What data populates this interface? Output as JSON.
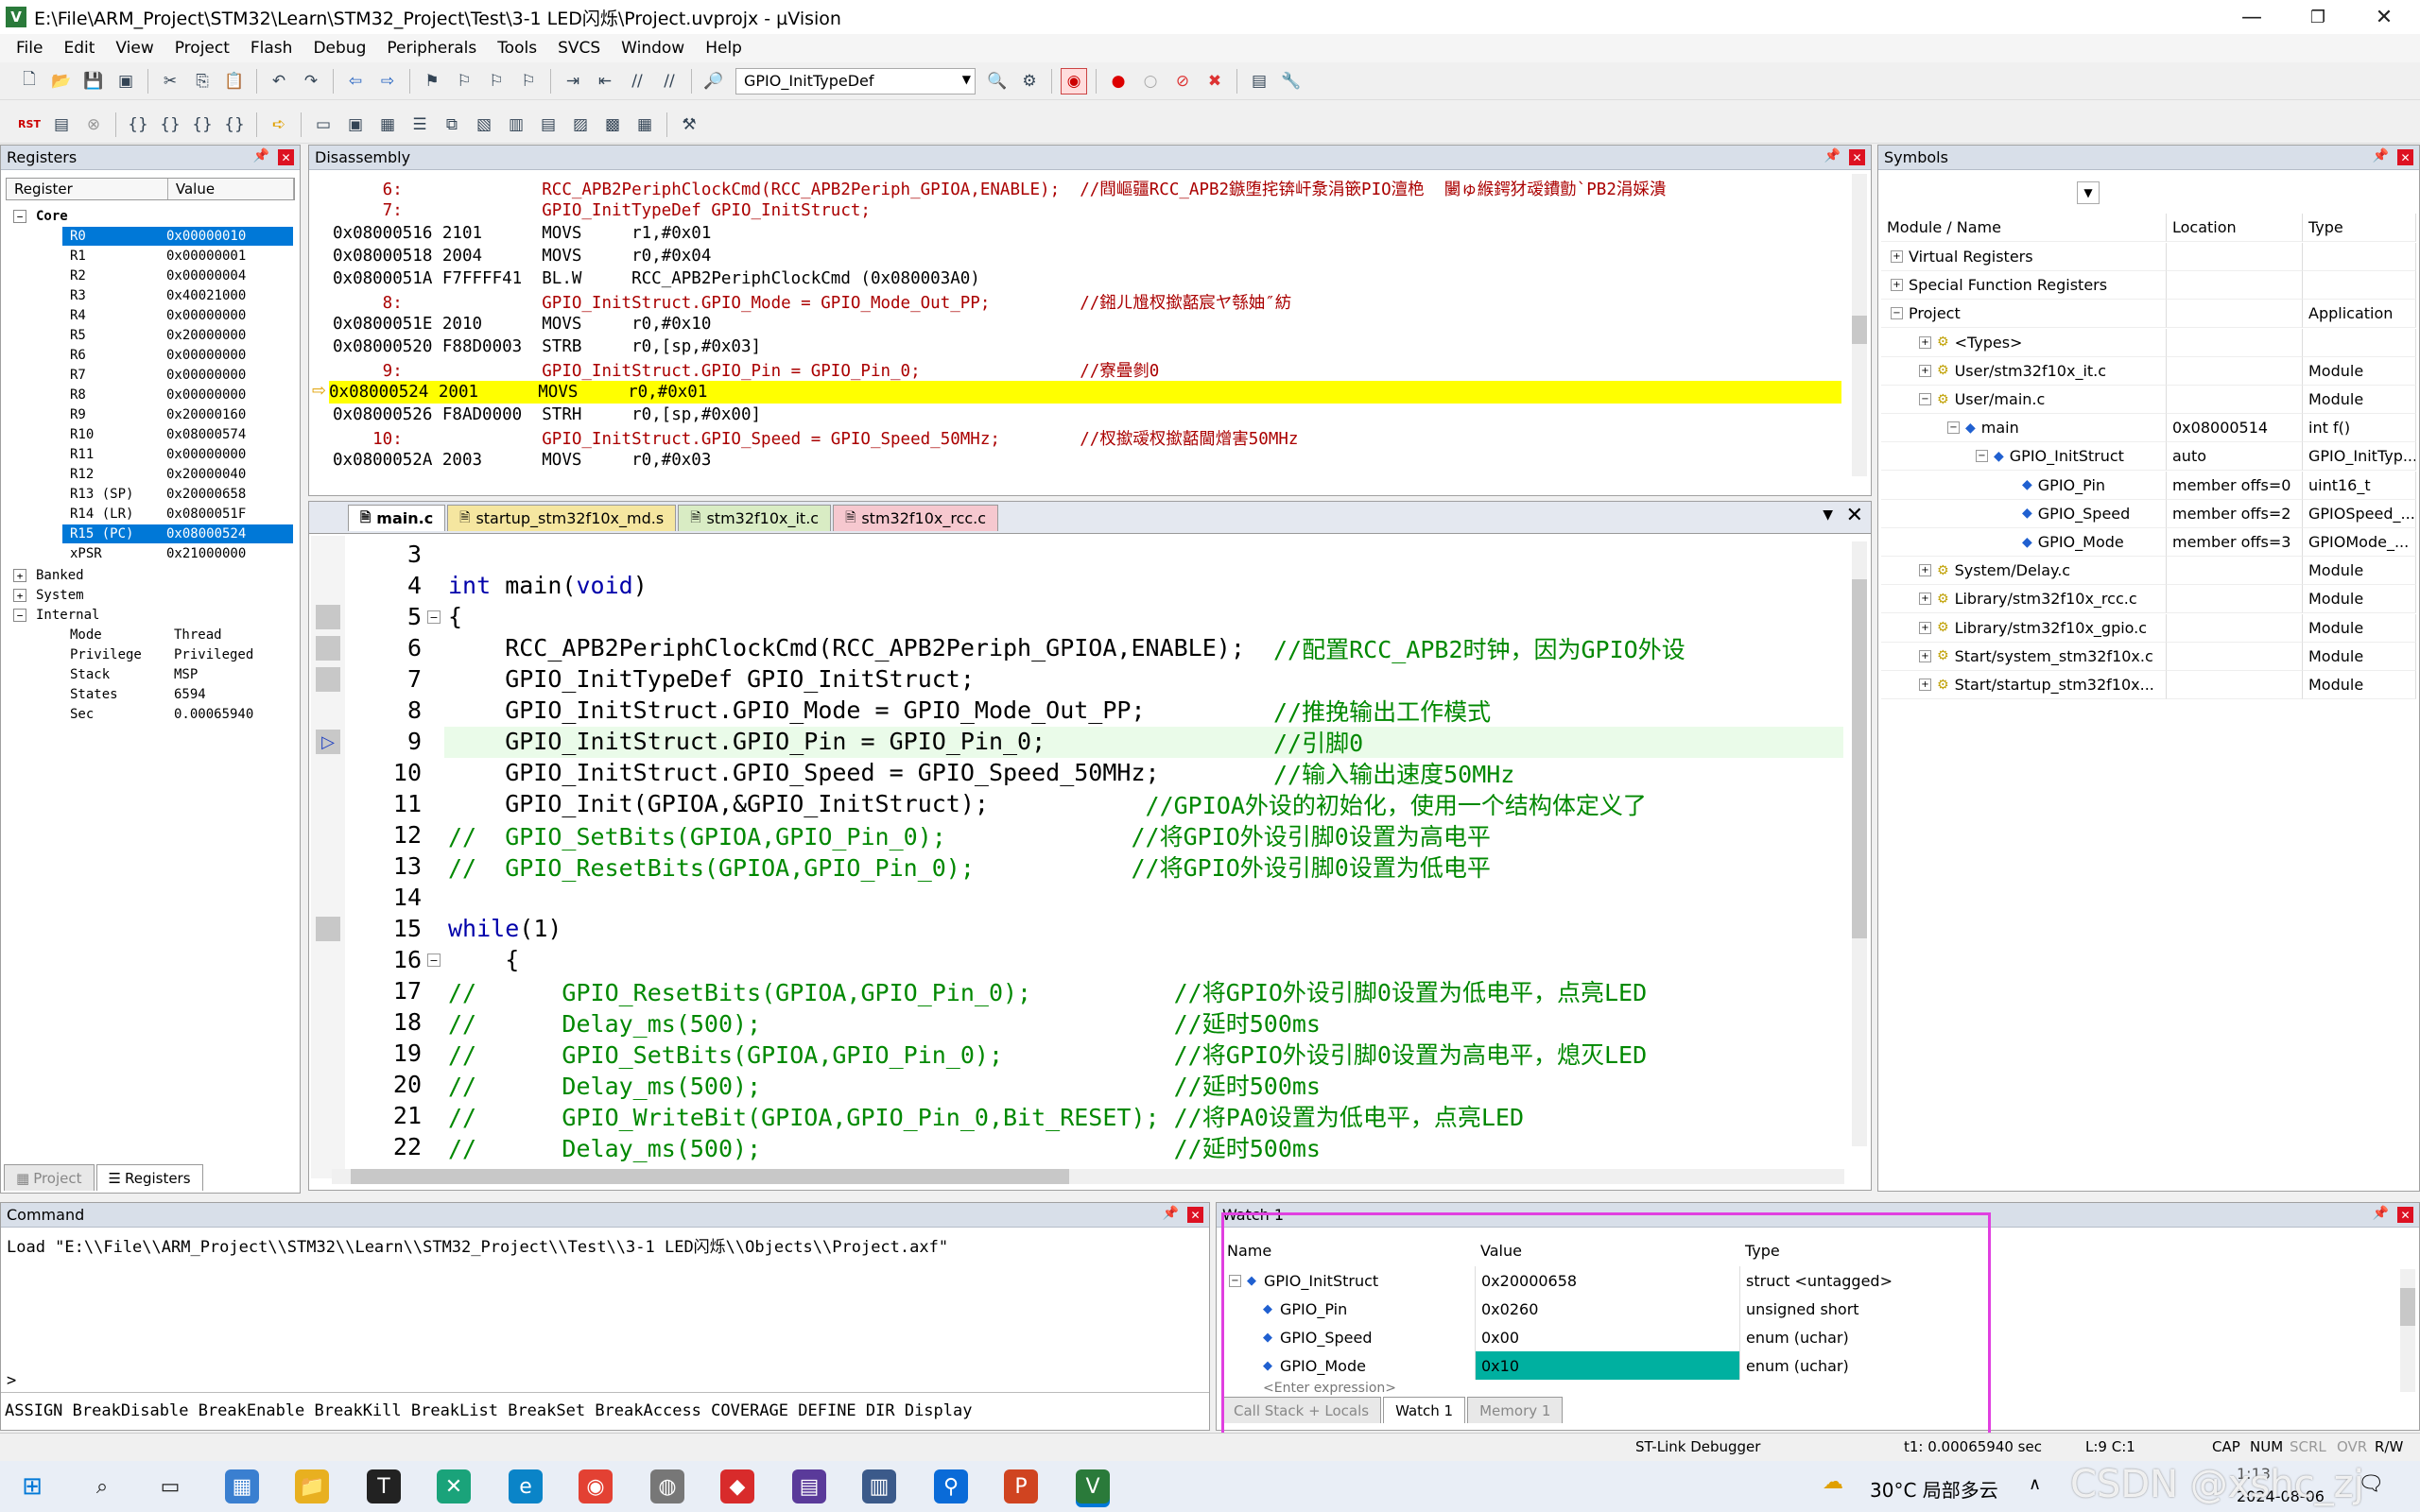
{
  "window": {
    "title": "E:\\File\\ARM_Project\\STM32\\Learn\\STM32_Project\\Test\\3-1 LED闪烁\\Project.uvprojx - µVision",
    "minimize": "—",
    "maximize": "❐",
    "close": "✕"
  },
  "menu": [
    "File",
    "Edit",
    "View",
    "Project",
    "Flash",
    "Debug",
    "Peripherals",
    "Tools",
    "SVCS",
    "Window",
    "Help"
  ],
  "toolbar": {
    "combo_value": "GPIO_InitTypeDef"
  },
  "registers": {
    "title": "Registers",
    "col_register": "Register",
    "col_value": "Value",
    "core_label": "Core",
    "rows": [
      {
        "name": "R0",
        "value": "0x00000010",
        "selected": true
      },
      {
        "name": "R1",
        "value": "0x00000001"
      },
      {
        "name": "R2",
        "value": "0x00000004"
      },
      {
        "name": "R3",
        "value": "0x40021000"
      },
      {
        "name": "R4",
        "value": "0x00000000"
      },
      {
        "name": "R5",
        "value": "0x20000000"
      },
      {
        "name": "R6",
        "value": "0x00000000"
      },
      {
        "name": "R7",
        "value": "0x00000000"
      },
      {
        "name": "R8",
        "value": "0x00000000"
      },
      {
        "name": "R9",
        "value": "0x20000160"
      },
      {
        "name": "R10",
        "value": "0x08000574"
      },
      {
        "name": "R11",
        "value": "0x00000000"
      },
      {
        "name": "R12",
        "value": "0x20000040"
      },
      {
        "name": "R13 (SP)",
        "value": "0x20000658"
      },
      {
        "name": "R14 (LR)",
        "value": "0x0800051F"
      },
      {
        "name": "R15 (PC)",
        "value": "0x08000524",
        "selected": true
      },
      {
        "name": "xPSR",
        "value": "0x21000000"
      }
    ],
    "banked": "Banked",
    "system": "System",
    "internal": "Internal",
    "internal_rows": [
      {
        "name": "Mode",
        "value": "Thread"
      },
      {
        "name": "Privilege",
        "value": "Privileged"
      },
      {
        "name": "Stack",
        "value": "MSP"
      },
      {
        "name": "States",
        "value": "6594"
      },
      {
        "name": "Sec",
        "value": "0.00065940"
      }
    ],
    "tab_project": "Project",
    "tab_registers": "Registers"
  },
  "disassembly": {
    "title": "Disassembly",
    "lines": [
      {
        "kind": "src",
        "text": "     6:              RCC_APB2PeriphClockCmd(RCC_APB2Periph_GPIOA,ENABLE);  //閰嶇疆RCC_APB2鏃堕挓锛屽洜涓篏PIO澶栬  闄ゅ緱鍔犲叆鐨勯`PB2涓婇潰"
      },
      {
        "kind": "src",
        "text": "     7:              GPIO_InitTypeDef GPIO_InitStruct;"
      },
      {
        "kind": "asm",
        "text": "0x08000516 2101      MOVS     r1,#0x01"
      },
      {
        "kind": "asm",
        "text": "0x08000518 2004      MOVS     r0,#0x04"
      },
      {
        "kind": "asm",
        "text": "0x0800051A F7FFFF41  BL.W     RCC_APB2PeriphClockCmd (0x080003A0)"
      },
      {
        "kind": "src",
        "text": "     8:              GPIO_InitStruct.GPIO_Mode = GPIO_Mode_Out_PP;         //鎺ㄦ尳杈撳嚭宸ヤ綔妯″紡"
      },
      {
        "kind": "asm",
        "text": "0x0800051E 2010      MOVS     r0,#0x10"
      },
      {
        "kind": "asm",
        "text": "0x08000520 F88D0003  STRB     r0,[sp,#0x03]"
      },
      {
        "kind": "src",
        "text": "     9:              GPIO_InitStruct.GPIO_Pin = GPIO_Pin_0;                //寮曡剼0"
      },
      {
        "kind": "asm",
        "text": "0x08000524 2001      MOVS     r0,#0x01",
        "current": true
      },
      {
        "kind": "asm",
        "text": "0x08000526 F8AD0000  STRH     r0,[sp,#0x00]"
      },
      {
        "kind": "src",
        "text": "    10:              GPIO_InitStruct.GPIO_Speed = GPIO_Speed_50MHz;        //杈撳叆杈撳嚭閫熷害50MHz"
      },
      {
        "kind": "asm",
        "text": "0x0800052A 2003      MOVS     r0,#0x03"
      }
    ]
  },
  "editor": {
    "tabs": [
      {
        "label": "main.c",
        "active": true,
        "color": "#ffffff"
      },
      {
        "label": "startup_stm32f10x_md.s",
        "color": "#f5e6a0"
      },
      {
        "label": "stm32f10x_it.c",
        "color": "#d9ecc4"
      },
      {
        "label": "stm32f10x_rcc.c",
        "color": "#f6c8cf"
      }
    ],
    "lines": [
      {
        "n": "3",
        "code": ""
      },
      {
        "n": "4",
        "code": "int main(void)"
      },
      {
        "n": "5",
        "code": "{"
      },
      {
        "n": "6",
        "code": "    RCC_APB2PeriphClockCmd(RCC_APB2Periph_GPIOA,ENABLE);  //配置RCC_APB2时钟，因为GPIO外设"
      },
      {
        "n": "7",
        "code": "    GPIO_InitTypeDef GPIO_InitStruct;"
      },
      {
        "n": "8",
        "code": "    GPIO_InitStruct.GPIO_Mode = GPIO_Mode_Out_PP;         //推挽输出工作模式"
      },
      {
        "n": "9",
        "code": "    GPIO_InitStruct.GPIO_Pin = GPIO_Pin_0;                //引脚0",
        "current": true
      },
      {
        "n": "10",
        "code": "    GPIO_InitStruct.GPIO_Speed = GPIO_Speed_50MHz;        //输入输出速度50MHz"
      },
      {
        "n": "11",
        "code": "    GPIO_Init(GPIOA,&GPIO_InitStruct);           //GPIOA外设的初始化，使用一个结构体定义了"
      },
      {
        "n": "12",
        "code": "//  GPIO_SetBits(GPIOA,GPIO_Pin_0);             //将GPIO外设引脚0设置为高电平"
      },
      {
        "n": "13",
        "code": "//  GPIO_ResetBits(GPIOA,GPIO_Pin_0);           //将GPIO外设引脚0设置为低电平"
      },
      {
        "n": "14",
        "code": ""
      },
      {
        "n": "15",
        "code": "    while(1)"
      },
      {
        "n": "16",
        "code": "    {"
      },
      {
        "n": "17",
        "code": "//      GPIO_ResetBits(GPIOA,GPIO_Pin_0);          //将GPIO外设引脚0设置为低电平，点亮LED"
      },
      {
        "n": "18",
        "code": "//      Delay_ms(500);                             //延时500ms"
      },
      {
        "n": "19",
        "code": "//      GPIO_SetBits(GPIOA,GPIO_Pin_0);            //将GPIO外设引脚0设置为高电平，熄灭LED"
      },
      {
        "n": "20",
        "code": "//      Delay_ms(500);                             //延时500ms"
      },
      {
        "n": "21",
        "code": "//      GPIO_WriteBit(GPIOA,GPIO_Pin_0,Bit_RESET); //将PA0设置为低电平，点亮LED"
      },
      {
        "n": "22",
        "code": "//      Delay_ms(500);                             //延时500ms"
      }
    ]
  },
  "symbols": {
    "title": "Symbols",
    "col_name": "Module / Name",
    "col_location": "Location",
    "col_type": "Type",
    "rows": [
      {
        "name": "Virtual Registers",
        "location": "",
        "type": "",
        "indent": 0,
        "expander": "+"
      },
      {
        "name": "Special Function Registers",
        "location": "",
        "type": "",
        "indent": 0,
        "expander": "+"
      },
      {
        "name": "Project",
        "location": "",
        "type": "Application",
        "indent": 0,
        "expander": "−"
      },
      {
        "name": "<Types>",
        "location": "",
        "type": "",
        "indent": 1,
        "expander": "+"
      },
      {
        "name": "User/stm32f10x_it.c",
        "location": "",
        "type": "Module",
        "indent": 1,
        "expander": "+"
      },
      {
        "name": "User/main.c",
        "location": "",
        "type": "Module",
        "indent": 1,
        "expander": "−"
      },
      {
        "name": "main",
        "location": "0x08000514",
        "type": "int f()",
        "indent": 2,
        "expander": "−"
      },
      {
        "name": "GPIO_InitStruct",
        "location": "auto",
        "type": "GPIO_InitTyp...",
        "indent": 3,
        "expander": "−"
      },
      {
        "name": "GPIO_Pin",
        "location": "member offs=0",
        "type": "uint16_t",
        "indent": 4,
        "expander": ""
      },
      {
        "name": "GPIO_Speed",
        "location": "member offs=2",
        "type": "GPIOSpeed_...",
        "indent": 4,
        "expander": ""
      },
      {
        "name": "GPIO_Mode",
        "location": "member offs=3",
        "type": "GPIOMode_...",
        "indent": 4,
        "expander": ""
      },
      {
        "name": "System/Delay.c",
        "location": "",
        "type": "Module",
        "indent": 1,
        "expander": "+"
      },
      {
        "name": "Library/stm32f10x_rcc.c",
        "location": "",
        "type": "Module",
        "indent": 1,
        "expander": "+"
      },
      {
        "name": "Library/stm32f10x_gpio.c",
        "location": "",
        "type": "Module",
        "indent": 1,
        "expander": "+"
      },
      {
        "name": "Start/system_stm32f10x.c",
        "location": "",
        "type": "Module",
        "indent": 1,
        "expander": "+"
      },
      {
        "name": "Start/startup_stm32f10x...",
        "location": "",
        "type": "Module",
        "indent": 1,
        "expander": "+"
      }
    ]
  },
  "command": {
    "title": "Command",
    "output": "Load \"E:\\\\File\\\\ARM_Project\\\\STM32\\\\Learn\\\\STM32_Project\\\\Test\\\\3-1 LED闪烁\\\\Objects\\\\Project.axf\"",
    "prompt": ">",
    "hints": "ASSIGN BreakDisable BreakEnable BreakKill BreakList BreakSet BreakAccess COVERAGE DEFINE DIR Display"
  },
  "watch": {
    "title": "Watch 1",
    "col_name": "Name",
    "col_value": "Value",
    "col_type": "Type",
    "rows": [
      {
        "name": "GPIO_InitStruct",
        "value": "0x20000658",
        "type": "struct <untagged>",
        "expander": "−",
        "indent": 0
      },
      {
        "name": "GPIO_Pin",
        "value": "0x0260",
        "type": "unsigned short",
        "indent": 1
      },
      {
        "name": "GPIO_Speed",
        "value": "0x00",
        "type": "enum (uchar)",
        "indent": 1
      },
      {
        "name": "GPIO_Mode",
        "value": "0x10",
        "type": "enum (uchar)",
        "indent": 1,
        "highlight": true
      }
    ],
    "enter_expr": "<Enter expression>",
    "tabs": [
      "Call Stack + Locals",
      "Watch 1",
      "Memory 1"
    ],
    "highlight_color": "#e040e0"
  },
  "statusbar": {
    "debugger": "ST-Link Debugger",
    "time": "t1: 0.00065940 sec",
    "position": "L:9 C:1",
    "flags": [
      "CAP",
      "NUM",
      "SCRL",
      "OVR",
      "R/W"
    ]
  },
  "taskbar": {
    "weather": "30°C 局部多云",
    "time": "1:13",
    "date": "2024-08-06",
    "watermark": "CSDN @xshc_zj"
  },
  "colors": {
    "accent": "#0078d7",
    "current_line": "#ffff00",
    "watch_value_highlight": "#00b0a0",
    "exec_line": "#e8f8e8"
  }
}
